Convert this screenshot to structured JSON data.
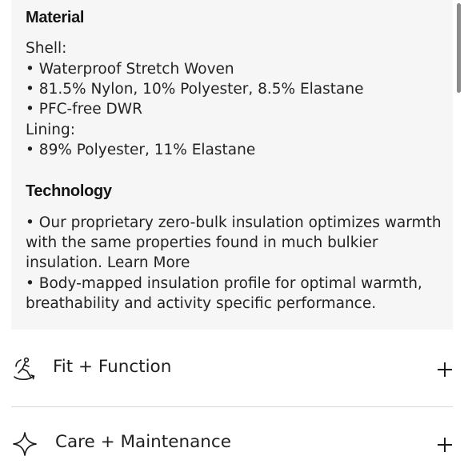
{
  "material": {
    "heading": "Material",
    "lines": [
      "Shell:",
      "• Waterproof Stretch Woven",
      "• 81.5% Nylon, 10% Polyester, 8.5% Elastane",
      "• PFC-free DWR",
      "Lining:",
      "• 89% Polyester, 11% Elastane"
    ]
  },
  "technology": {
    "heading": "Technology",
    "lines": [
      "• Our proprietary zero-bulk insulation optimizes warmth",
      "with the same properties found in much bulkier",
      "insulation. Learn More",
      "• Body-mapped insulation profile for optimal warmth,",
      "breathability and activity specific performance."
    ]
  },
  "accordions": [
    {
      "label": "Fit + Function",
      "icon": "body-movement-icon",
      "expand_icon": "plus-icon"
    },
    {
      "label": "Care + Maintenance",
      "icon": "diamond-sparkle-icon",
      "expand_icon": "plus-icon"
    }
  ]
}
